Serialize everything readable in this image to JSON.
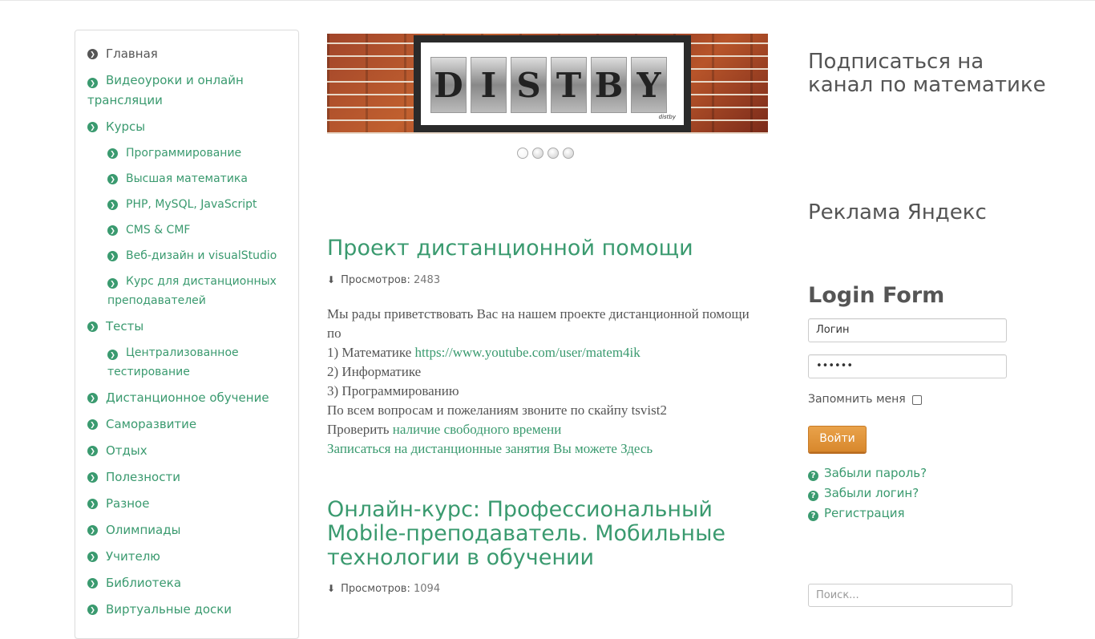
{
  "sidebar": {
    "items": [
      {
        "label": "Главная"
      },
      {
        "label": "Видеоуроки и онлайн трансляции"
      },
      {
        "label": "Курсы"
      },
      {
        "label": "Тесты"
      },
      {
        "label": "Дистанционное обучение"
      },
      {
        "label": "Саморазвитие"
      },
      {
        "label": "Отдых"
      },
      {
        "label": "Полезности"
      },
      {
        "label": "Разное"
      },
      {
        "label": "Олимпиады"
      },
      {
        "label": "Учителю"
      },
      {
        "label": "Библиотека"
      },
      {
        "label": "Виртуальные доски"
      }
    ],
    "courses_sub": [
      {
        "label": "Программирование"
      },
      {
        "label": "Высшая математика"
      },
      {
        "label": "PHP, MySQL, JavaScript"
      },
      {
        "label": "CMS & CMF"
      },
      {
        "label": "Веб-дизайн и visualStudio"
      },
      {
        "label": "Курс для дистанционных преподавателей"
      }
    ],
    "tests_sub": [
      {
        "label": "Централизованное тестирование"
      }
    ]
  },
  "banner": {
    "letters": [
      "D",
      "I",
      "S",
      "T",
      "B",
      "Y"
    ],
    "signature": "distby"
  },
  "articles": [
    {
      "title": "Проект дистанционной помощи",
      "hits_label": "Просмотров:",
      "hits": "2483",
      "lines": {
        "l1": "Мы рады приветствовать Вас на нашем проекте дистанционной помощи по",
        "l2_prefix": "1) Математике",
        "l2_link": "https://www.youtube.com/user/matem4ik",
        "l3": "2) Информатике",
        "l4": "3) Программированию",
        "l5": "По всем вопросам и пожеланиям звоните по скайпу tsvist2",
        "l6_prefix": "Проверить",
        "l6_link": "наличие свободного времени",
        "l7_link": "Записаться на дистанционные занятия Вы можете Здесь"
      }
    },
    {
      "title": "Онлайн-курс: Профессиональный Mobile-преподаватель. Мобильные технологии в обучении",
      "hits_label": "Просмотров:",
      "hits": "1094"
    }
  ],
  "right": {
    "subscribe_title": "Подписаться на канал по математике",
    "ads_title": "Реклама Яндекс",
    "login": {
      "title": "Login Form",
      "username_value": "Логин",
      "password_value": "••••••",
      "remember_label": "Запомнить меня",
      "submit_label": "Войти",
      "links": [
        {
          "label": "Забыли пароль?"
        },
        {
          "label": "Забыли логин?"
        },
        {
          "label": "Регистрация"
        }
      ]
    },
    "search_placeholder": "Поиск..."
  },
  "colors": {
    "accent": "#3a9a6f",
    "text": "#555555",
    "button": "#de8f35"
  },
  "icons": {
    "menu_bullet": "chevron-circle-right-icon",
    "hits": "download-icon",
    "help": "question-circle-icon"
  }
}
